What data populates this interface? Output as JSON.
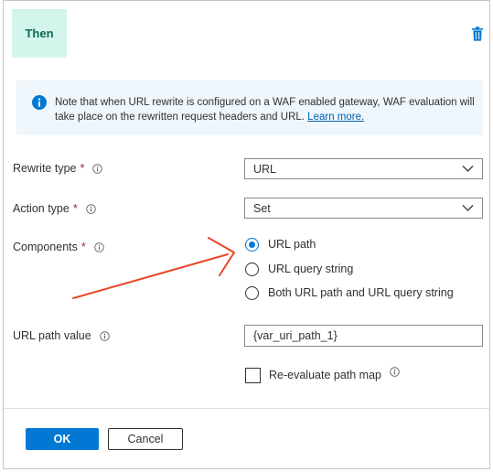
{
  "section": {
    "badge_label": "Then"
  },
  "info": {
    "message": "Note that when URL rewrite is configured on a WAF enabled gateway, WAF evaluation will take place on the rewritten request headers and URL.",
    "link_label": "Learn more."
  },
  "form": {
    "rewrite_type": {
      "label": "Rewrite type",
      "required_mark": "*",
      "value": "URL"
    },
    "action_type": {
      "label": "Action type",
      "required_mark": "*",
      "value": "Set"
    },
    "components": {
      "label": "Components",
      "required_mark": "*",
      "options": [
        {
          "label": "URL path",
          "checked": true
        },
        {
          "label": "URL query string",
          "checked": false
        },
        {
          "label": "Both URL path and URL query string",
          "checked": false
        }
      ]
    },
    "url_path_value": {
      "label": "URL path value",
      "value": "{var_uri_path_1}"
    },
    "reevaluate": {
      "label": "Re-evaluate path map",
      "checked": false
    }
  },
  "footer": {
    "ok_label": "OK",
    "cancel_label": "Cancel"
  },
  "colors": {
    "primary": "#0078d4",
    "badge_bg": "#d3f5ec",
    "badge_text": "#0b6a53",
    "info_bg": "#eff6fc",
    "required": "#a4262c",
    "annotation_arrow": "#e8472a"
  },
  "icons": {
    "delete": "trash-icon",
    "info": "info-icon",
    "hint": "info-circle-icon",
    "dropdown": "chevron-down-icon"
  }
}
